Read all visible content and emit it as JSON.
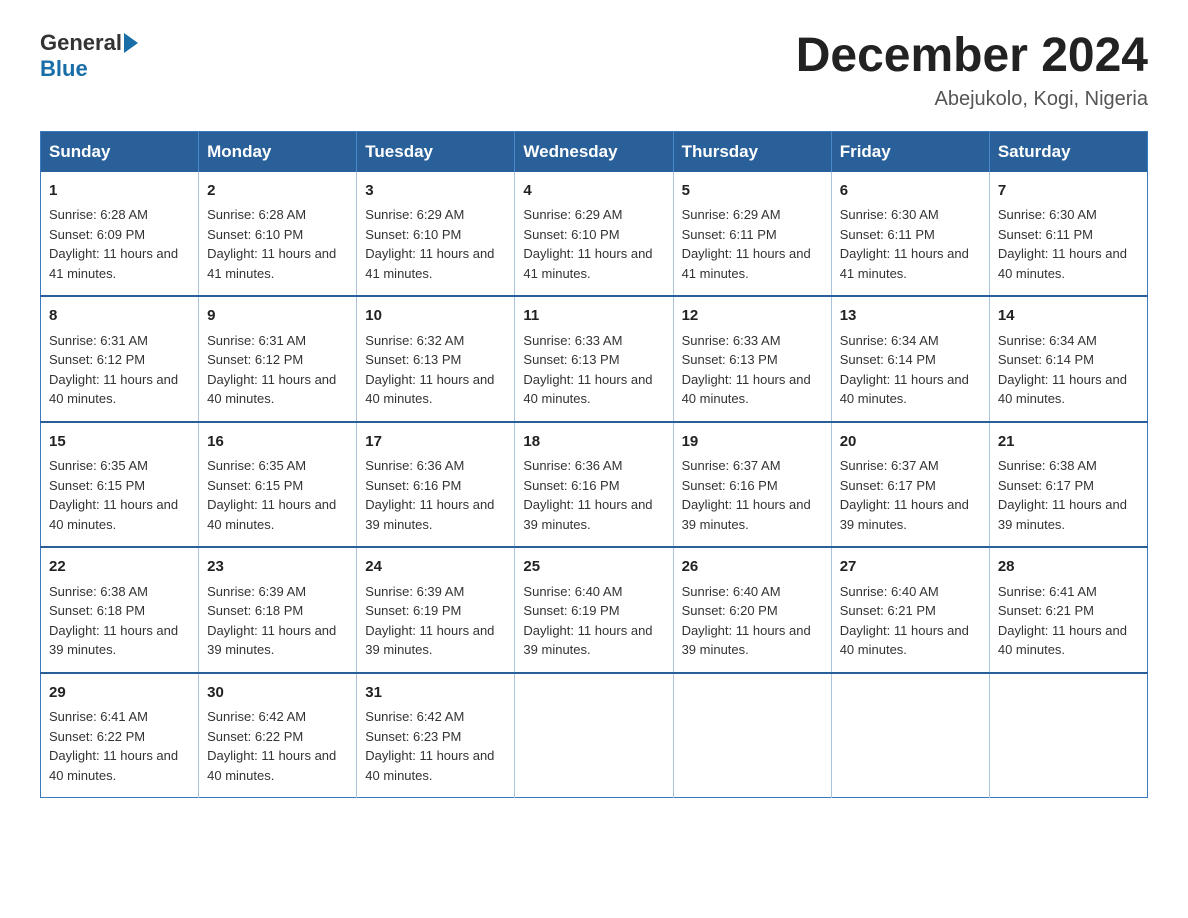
{
  "header": {
    "logo_general": "General",
    "logo_blue": "Blue",
    "month_title": "December 2024",
    "location": "Abejukolo, Kogi, Nigeria"
  },
  "days_of_week": [
    "Sunday",
    "Monday",
    "Tuesday",
    "Wednesday",
    "Thursday",
    "Friday",
    "Saturday"
  ],
  "weeks": [
    [
      {
        "day": "1",
        "sunrise": "6:28 AM",
        "sunset": "6:09 PM",
        "daylight": "11 hours and 41 minutes."
      },
      {
        "day": "2",
        "sunrise": "6:28 AM",
        "sunset": "6:10 PM",
        "daylight": "11 hours and 41 minutes."
      },
      {
        "day": "3",
        "sunrise": "6:29 AM",
        "sunset": "6:10 PM",
        "daylight": "11 hours and 41 minutes."
      },
      {
        "day": "4",
        "sunrise": "6:29 AM",
        "sunset": "6:10 PM",
        "daylight": "11 hours and 41 minutes."
      },
      {
        "day": "5",
        "sunrise": "6:29 AM",
        "sunset": "6:11 PM",
        "daylight": "11 hours and 41 minutes."
      },
      {
        "day": "6",
        "sunrise": "6:30 AM",
        "sunset": "6:11 PM",
        "daylight": "11 hours and 41 minutes."
      },
      {
        "day": "7",
        "sunrise": "6:30 AM",
        "sunset": "6:11 PM",
        "daylight": "11 hours and 40 minutes."
      }
    ],
    [
      {
        "day": "8",
        "sunrise": "6:31 AM",
        "sunset": "6:12 PM",
        "daylight": "11 hours and 40 minutes."
      },
      {
        "day": "9",
        "sunrise": "6:31 AM",
        "sunset": "6:12 PM",
        "daylight": "11 hours and 40 minutes."
      },
      {
        "day": "10",
        "sunrise": "6:32 AM",
        "sunset": "6:13 PM",
        "daylight": "11 hours and 40 minutes."
      },
      {
        "day": "11",
        "sunrise": "6:33 AM",
        "sunset": "6:13 PM",
        "daylight": "11 hours and 40 minutes."
      },
      {
        "day": "12",
        "sunrise": "6:33 AM",
        "sunset": "6:13 PM",
        "daylight": "11 hours and 40 minutes."
      },
      {
        "day": "13",
        "sunrise": "6:34 AM",
        "sunset": "6:14 PM",
        "daylight": "11 hours and 40 minutes."
      },
      {
        "day": "14",
        "sunrise": "6:34 AM",
        "sunset": "6:14 PM",
        "daylight": "11 hours and 40 minutes."
      }
    ],
    [
      {
        "day": "15",
        "sunrise": "6:35 AM",
        "sunset": "6:15 PM",
        "daylight": "11 hours and 40 minutes."
      },
      {
        "day": "16",
        "sunrise": "6:35 AM",
        "sunset": "6:15 PM",
        "daylight": "11 hours and 40 minutes."
      },
      {
        "day": "17",
        "sunrise": "6:36 AM",
        "sunset": "6:16 PM",
        "daylight": "11 hours and 39 minutes."
      },
      {
        "day": "18",
        "sunrise": "6:36 AM",
        "sunset": "6:16 PM",
        "daylight": "11 hours and 39 minutes."
      },
      {
        "day": "19",
        "sunrise": "6:37 AM",
        "sunset": "6:16 PM",
        "daylight": "11 hours and 39 minutes."
      },
      {
        "day": "20",
        "sunrise": "6:37 AM",
        "sunset": "6:17 PM",
        "daylight": "11 hours and 39 minutes."
      },
      {
        "day": "21",
        "sunrise": "6:38 AM",
        "sunset": "6:17 PM",
        "daylight": "11 hours and 39 minutes."
      }
    ],
    [
      {
        "day": "22",
        "sunrise": "6:38 AM",
        "sunset": "6:18 PM",
        "daylight": "11 hours and 39 minutes."
      },
      {
        "day": "23",
        "sunrise": "6:39 AM",
        "sunset": "6:18 PM",
        "daylight": "11 hours and 39 minutes."
      },
      {
        "day": "24",
        "sunrise": "6:39 AM",
        "sunset": "6:19 PM",
        "daylight": "11 hours and 39 minutes."
      },
      {
        "day": "25",
        "sunrise": "6:40 AM",
        "sunset": "6:19 PM",
        "daylight": "11 hours and 39 minutes."
      },
      {
        "day": "26",
        "sunrise": "6:40 AM",
        "sunset": "6:20 PM",
        "daylight": "11 hours and 39 minutes."
      },
      {
        "day": "27",
        "sunrise": "6:40 AM",
        "sunset": "6:21 PM",
        "daylight": "11 hours and 40 minutes."
      },
      {
        "day": "28",
        "sunrise": "6:41 AM",
        "sunset": "6:21 PM",
        "daylight": "11 hours and 40 minutes."
      }
    ],
    [
      {
        "day": "29",
        "sunrise": "6:41 AM",
        "sunset": "6:22 PM",
        "daylight": "11 hours and 40 minutes."
      },
      {
        "day": "30",
        "sunrise": "6:42 AM",
        "sunset": "6:22 PM",
        "daylight": "11 hours and 40 minutes."
      },
      {
        "day": "31",
        "sunrise": "6:42 AM",
        "sunset": "6:23 PM",
        "daylight": "11 hours and 40 minutes."
      },
      null,
      null,
      null,
      null
    ]
  ]
}
